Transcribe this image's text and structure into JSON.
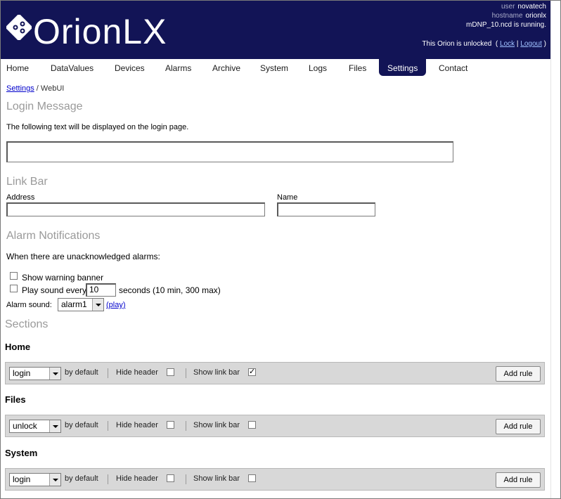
{
  "header": {
    "logo_text": "OrionLX",
    "user_label": "user",
    "user_value": "novatech",
    "host_label": "hostname",
    "host_value": "orionlx",
    "running": "mDNP_10.ncd is running.",
    "lock_status": "This Orion is unlocked",
    "lock_link": "Lock",
    "logout_link": "Logout"
  },
  "nav": [
    "Home",
    "DataValues",
    "Devices",
    "Alarms",
    "Archive",
    "System",
    "Logs",
    "Files",
    "Settings",
    "Contact"
  ],
  "breadcrumb": {
    "parent": "Settings",
    "current": "WebUI"
  },
  "login_message": {
    "title": "Login Message",
    "description": "The following text will be displayed on the login page.",
    "value": ""
  },
  "link_bar": {
    "title": "Link Bar",
    "address_label": "Address",
    "name_label": "Name",
    "address_value": "",
    "name_value": ""
  },
  "alarms": {
    "title": "Alarm Notifications",
    "intro": "When there are unacknowledged alarms:",
    "show_banner": "Show warning banner",
    "play_sound": "Play sound every",
    "interval": "10",
    "interval_suffix": "seconds (10 min, 300 max)",
    "sound_label": "Alarm sound:",
    "sound_value": "alarm1",
    "play_link": "(play)"
  },
  "sections": {
    "title": "Sections",
    "by_default": "by default",
    "hide_header": "Hide header",
    "show_link_bar": "Show link bar",
    "add_rule": "Add rule",
    "items": [
      {
        "name": "Home",
        "default": "login",
        "hide_header": false,
        "show_link_bar": true
      },
      {
        "name": "Files",
        "default": "unlock",
        "hide_header": false,
        "show_link_bar": false
      },
      {
        "name": "System",
        "default": "login",
        "hide_header": false,
        "show_link_bar": false
      }
    ]
  }
}
